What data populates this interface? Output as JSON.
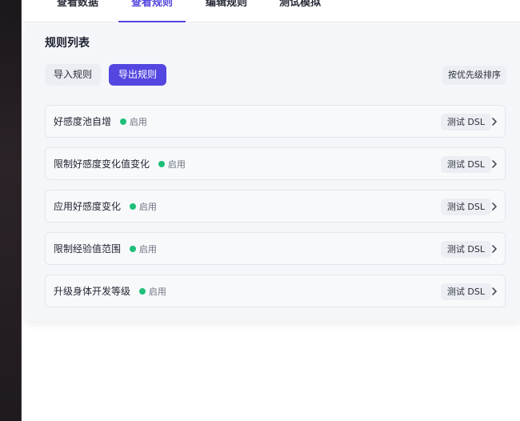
{
  "tabs": [
    {
      "label": "查看数据"
    },
    {
      "label": "查看规则"
    },
    {
      "label": "编辑规则"
    },
    {
      "label": "测试模拟"
    }
  ],
  "panel": {
    "title": "规则列表",
    "import_label": "导入规则",
    "export_label": "导出规则",
    "sort_label": "按优先级排序"
  },
  "rules": [
    {
      "name": "好感度池自增",
      "status": "启用",
      "test_label": "测试 DSL"
    },
    {
      "name": "限制好感度变化值变化",
      "status": "启用",
      "test_label": "测试 DSL"
    },
    {
      "name": "应用好感度变化",
      "status": "启用",
      "test_label": "测试 DSL"
    },
    {
      "name": "限制经验值范围",
      "status": "启用",
      "test_label": "测试 DSL"
    },
    {
      "name": "升级身体开发等级",
      "status": "启用",
      "test_label": "测试 DSL"
    }
  ],
  "colors": {
    "accent": "#5446e0",
    "status_enabled": "#1fbf7a"
  },
  "icons": {
    "status": "status-dot-icon",
    "chevron": "chevron-right-icon"
  }
}
